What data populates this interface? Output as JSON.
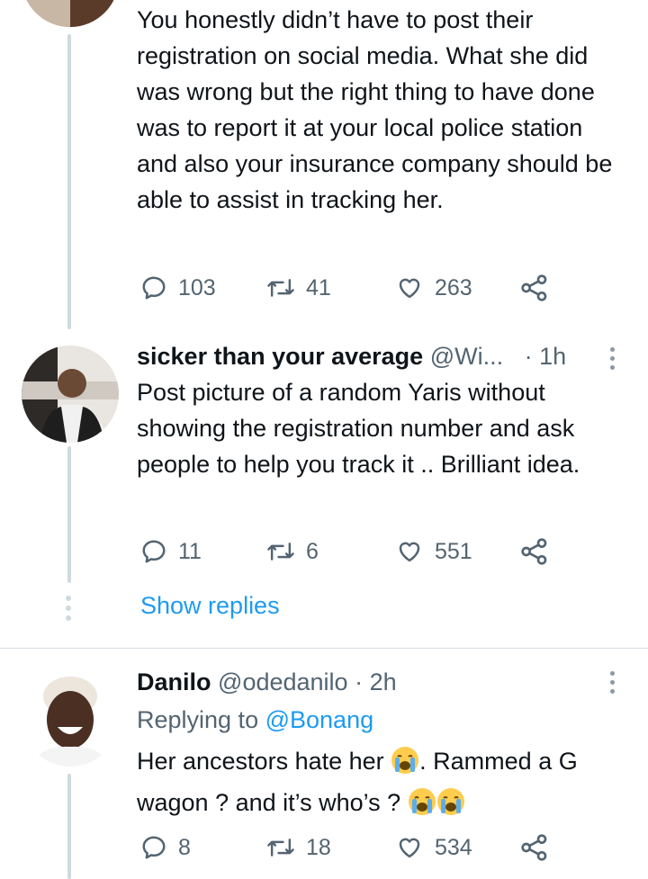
{
  "tweet1": {
    "text": "You honestly didn’t have to post their registration on social media. What she did was wrong but the right thing to have done was to report it at your local police station and also your insurance company should be able to assist in tracking her.",
    "replies": "103",
    "retweets": "41",
    "likes": "263"
  },
  "tweet2": {
    "name": "sicker than your average",
    "handle": "@Wi...",
    "time": "· 1h",
    "text": "Post picture of a random Yaris without showing the registration number and ask people to help you track it .. Brilliant idea.",
    "replies": "11",
    "retweets": "6",
    "likes": "551"
  },
  "show_replies": "Show replies",
  "tweet3": {
    "name": "Danilo",
    "handle": "@odedanilo",
    "time": "· 2h",
    "replying_prefix": "Replying to",
    "replying_mention": "@Bonang",
    "text_part1": "Her ancestors hate her",
    "text_part2": ". Rammed a G wagon ? and it’s who’s ?",
    "replies": "8",
    "retweets": "18",
    "likes": "534"
  },
  "icons": {
    "reply": "reply-icon",
    "retweet": "retweet-icon",
    "like": "heart-icon",
    "share": "share-icon",
    "more": "more-vertical-icon",
    "crying": "loudly-crying-face-emoji"
  },
  "colors": {
    "link": "#1d9bf0",
    "muted": "#536471",
    "thread": "#cfd9de"
  }
}
